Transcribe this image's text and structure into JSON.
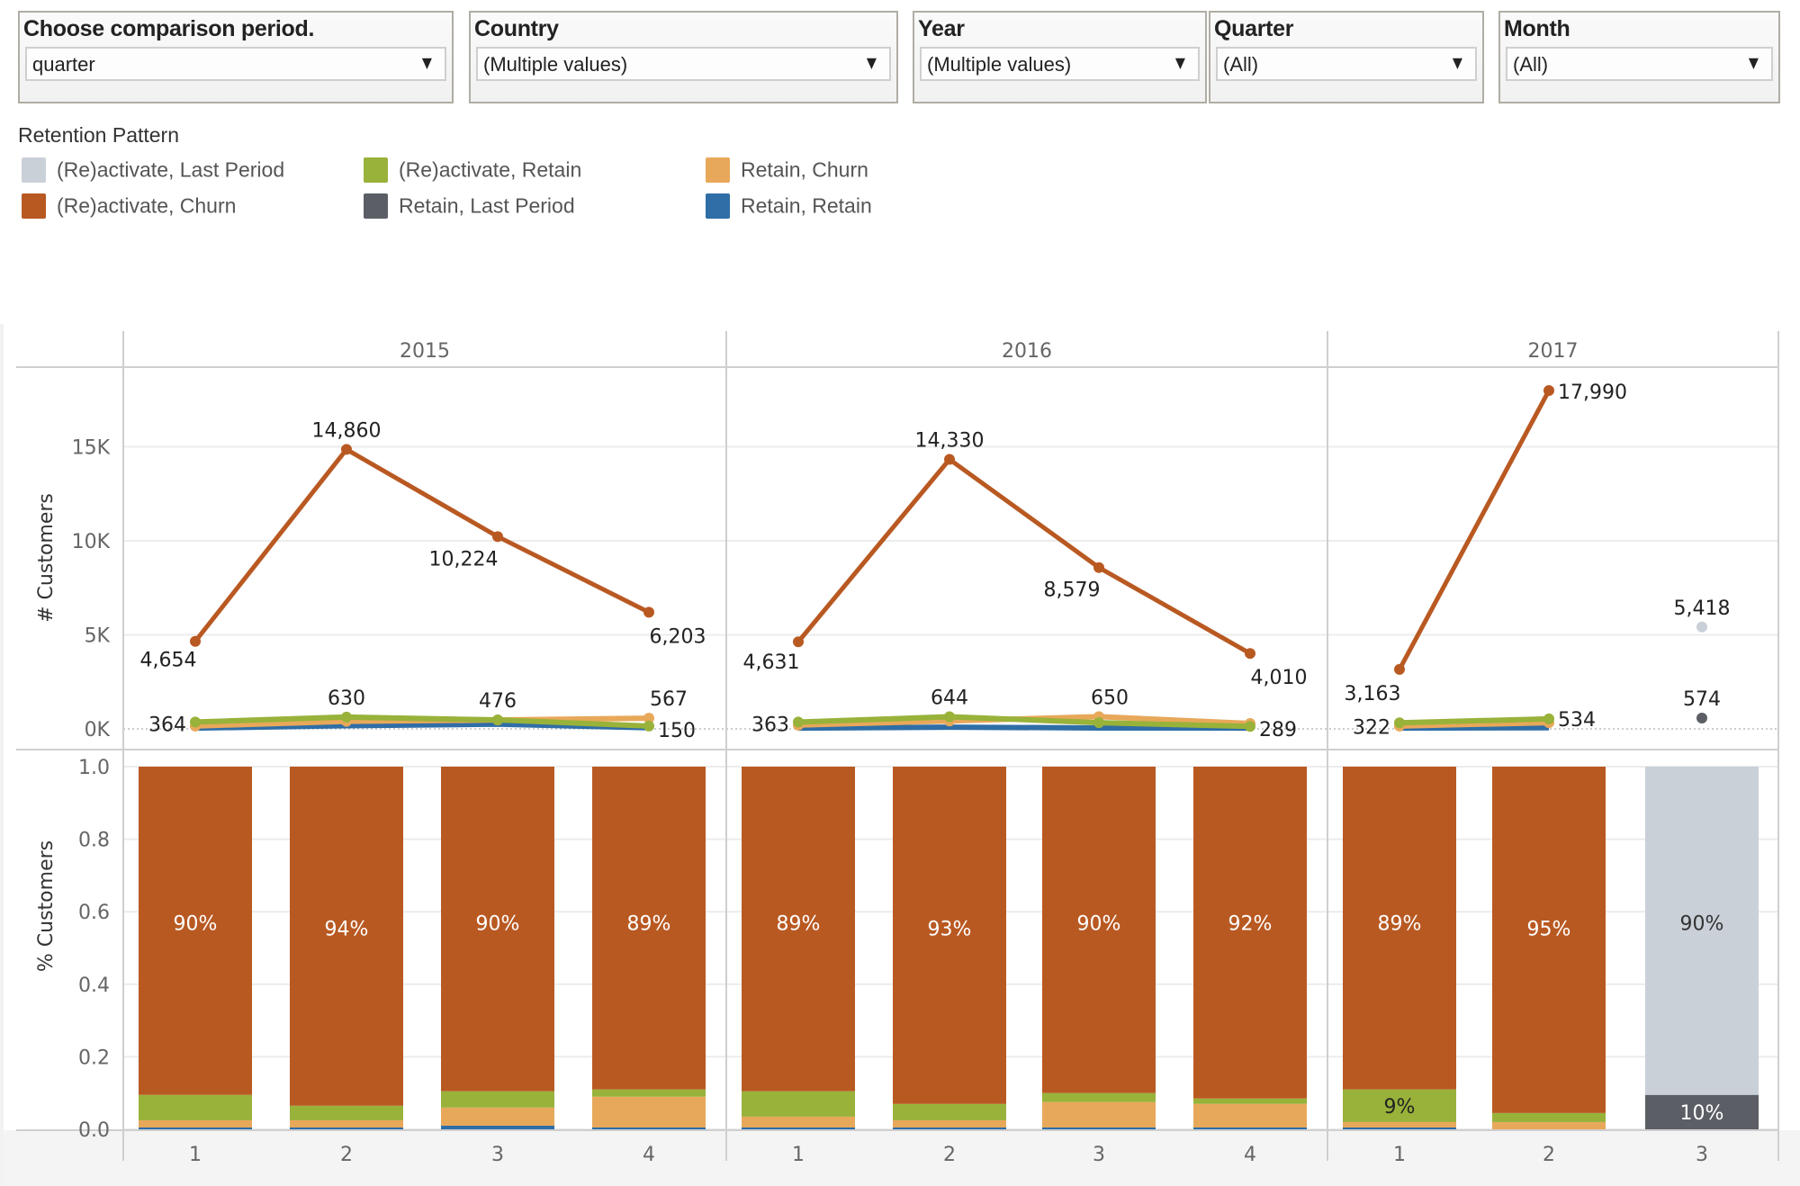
{
  "filters": [
    {
      "title": "Choose comparison period.",
      "value": "quarter",
      "arrow": "▼"
    },
    {
      "title": "Country",
      "value": "(Multiple values)",
      "arrow": "▼"
    },
    {
      "title": "Year",
      "value": "(Multiple values)",
      "arrow": "▼"
    },
    {
      "title": "Quarter",
      "value": "(All)",
      "arrow": "▼"
    },
    {
      "title": "Month",
      "value": "(All)",
      "arrow": "▼"
    }
  ],
  "legend": {
    "title": "Retention Pattern",
    "items": [
      {
        "label": "(Re)activate, Last Period",
        "color": "#c9d0d8"
      },
      {
        "label": "(Re)activate, Churn",
        "color": "#b95922"
      },
      {
        "label": "(Re)activate, Retain",
        "color": "#98b23a"
      },
      {
        "label": "Retain, Last Period",
        "color": "#5b5f65"
      },
      {
        "label": "Retain, Churn",
        "color": "#e8a85a"
      },
      {
        "label": "Retain, Retain",
        "color": "#2f6ea6"
      }
    ]
  },
  "chart_data": [
    {
      "type": "line",
      "title": "",
      "ylabel": "# Customers",
      "xlabel": "",
      "ylim": [
        0,
        19000
      ],
      "yticks": [
        "0K",
        "5K",
        "10K",
        "15K"
      ],
      "ytick_values": [
        0,
        5000,
        10000,
        15000
      ],
      "grid": true,
      "panels": [
        "2015",
        "2016",
        "2017"
      ],
      "categories": [
        {
          "year": "2015",
          "quarter": "1"
        },
        {
          "year": "2015",
          "quarter": "2"
        },
        {
          "year": "2015",
          "quarter": "3"
        },
        {
          "year": "2015",
          "quarter": "4"
        },
        {
          "year": "2016",
          "quarter": "1"
        },
        {
          "year": "2016",
          "quarter": "2"
        },
        {
          "year": "2016",
          "quarter": "3"
        },
        {
          "year": "2016",
          "quarter": "4"
        },
        {
          "year": "2017",
          "quarter": "1"
        },
        {
          "year": "2017",
          "quarter": "2"
        },
        {
          "year": "2017",
          "quarter": "3"
        }
      ],
      "series": [
        {
          "name": "(Re)activate, Churn",
          "color": "#b95922",
          "values": [
            4654,
            14860,
            10224,
            6203,
            4631,
            14330,
            8579,
            4010,
            3163,
            17990,
            null
          ],
          "labels": [
            "4,654",
            "14,860",
            "10,224",
            "6,203",
            "4,631",
            "14,330",
            "8,579",
            "4,010",
            "3,163",
            "17,990",
            null
          ]
        },
        {
          "name": "(Re)activate, Retain",
          "color": "#98b23a",
          "values": [
            364,
            630,
            476,
            150,
            363,
            644,
            330,
            130,
            322,
            534,
            null
          ],
          "labels": [
            "364",
            "630",
            "476",
            "150",
            "363",
            "644",
            null,
            null,
            "322",
            "534",
            null
          ]
        },
        {
          "name": "Retain, Churn",
          "color": "#e8a85a",
          "values": [
            150,
            400,
            470,
            567,
            200,
            420,
            650,
            289,
            150,
            330,
            null
          ],
          "labels": [
            null,
            null,
            null,
            "567",
            null,
            null,
            "650",
            "289",
            null,
            null,
            null
          ]
        },
        {
          "name": "Retain, Retain",
          "color": "#2f6ea6",
          "values": [
            40,
            170,
            250,
            60,
            40,
            90,
            50,
            40,
            40,
            60,
            null
          ],
          "labels": []
        },
        {
          "name": "(Re)activate, Last Period",
          "color": "#c9d0d8",
          "values": [
            null,
            null,
            null,
            null,
            null,
            null,
            null,
            null,
            null,
            null,
            5418
          ],
          "labels": [
            null,
            null,
            null,
            null,
            null,
            null,
            null,
            null,
            null,
            null,
            "5,418"
          ]
        },
        {
          "name": "Retain, Last Period",
          "color": "#5b5f65",
          "values": [
            null,
            null,
            null,
            null,
            null,
            null,
            null,
            null,
            null,
            null,
            574
          ],
          "labels": [
            null,
            null,
            null,
            null,
            null,
            null,
            null,
            null,
            null,
            null,
            "574"
          ]
        }
      ]
    },
    {
      "type": "bar",
      "stacked": true,
      "title": "",
      "ylabel": "% Customers",
      "xlabel": "",
      "ylim": [
        0,
        1
      ],
      "yticks": [
        "0.0",
        "0.2",
        "0.4",
        "0.6",
        "0.8",
        "1.0"
      ],
      "ytick_values": [
        0,
        0.2,
        0.4,
        0.6,
        0.8,
        1.0
      ],
      "grid": true,
      "panels": [
        "2015",
        "2016",
        "2017"
      ],
      "x_tick_labels": [
        "1",
        "2",
        "3",
        "4",
        "1",
        "2",
        "3",
        "4",
        "1",
        "2",
        "3"
      ],
      "series": [
        {
          "name": "Retain, Retain",
          "color": "#2f6ea6",
          "values": [
            0.005,
            0.005,
            0.01,
            0.005,
            0.005,
            0.005,
            0.005,
            0.005,
            0.005,
            0.0,
            0.0
          ]
        },
        {
          "name": "Retain, Churn",
          "color": "#e8a85a",
          "values": [
            0.02,
            0.02,
            0.05,
            0.085,
            0.03,
            0.02,
            0.07,
            0.065,
            0.015,
            0.02,
            0.0
          ]
        },
        {
          "name": "(Re)activate, Retain",
          "color": "#98b23a",
          "values": [
            0.07,
            0.04,
            0.045,
            0.02,
            0.07,
            0.045,
            0.025,
            0.015,
            0.09,
            0.025,
            0.0
          ]
        },
        {
          "name": "(Re)activate, Churn",
          "color": "#b95922",
          "values": [
            0.905,
            0.935,
            0.895,
            0.89,
            0.895,
            0.93,
            0.9,
            0.915,
            0.89,
            0.955,
            0.0
          ]
        },
        {
          "name": "Retain, Last Period",
          "color": "#5b5f65",
          "values": [
            0,
            0,
            0,
            0,
            0,
            0,
            0,
            0,
            0,
            0,
            0.095
          ]
        },
        {
          "name": "(Re)activate, Last Period",
          "color": "#c9d0d8",
          "values": [
            0,
            0,
            0,
            0,
            0,
            0,
            0,
            0,
            0,
            0,
            0.905
          ]
        }
      ],
      "data_labels": [
        {
          "index": 0,
          "series": "(Re)activate, Churn",
          "text": "90%"
        },
        {
          "index": 1,
          "series": "(Re)activate, Churn",
          "text": "94%"
        },
        {
          "index": 2,
          "series": "(Re)activate, Churn",
          "text": "90%"
        },
        {
          "index": 3,
          "series": "(Re)activate, Churn",
          "text": "89%"
        },
        {
          "index": 4,
          "series": "(Re)activate, Churn",
          "text": "89%"
        },
        {
          "index": 5,
          "series": "(Re)activate, Churn",
          "text": "93%"
        },
        {
          "index": 6,
          "series": "(Re)activate, Churn",
          "text": "90%"
        },
        {
          "index": 7,
          "series": "(Re)activate, Churn",
          "text": "92%"
        },
        {
          "index": 8,
          "series": "(Re)activate, Churn",
          "text": "89%"
        },
        {
          "index": 8,
          "series": "(Re)activate, Retain",
          "text": "9%"
        },
        {
          "index": 9,
          "series": "(Re)activate, Churn",
          "text": "95%"
        },
        {
          "index": 10,
          "series": "(Re)activate, Last Period",
          "text": "90%"
        },
        {
          "index": 10,
          "series": "Retain, Last Period",
          "text": "10%"
        }
      ]
    }
  ]
}
